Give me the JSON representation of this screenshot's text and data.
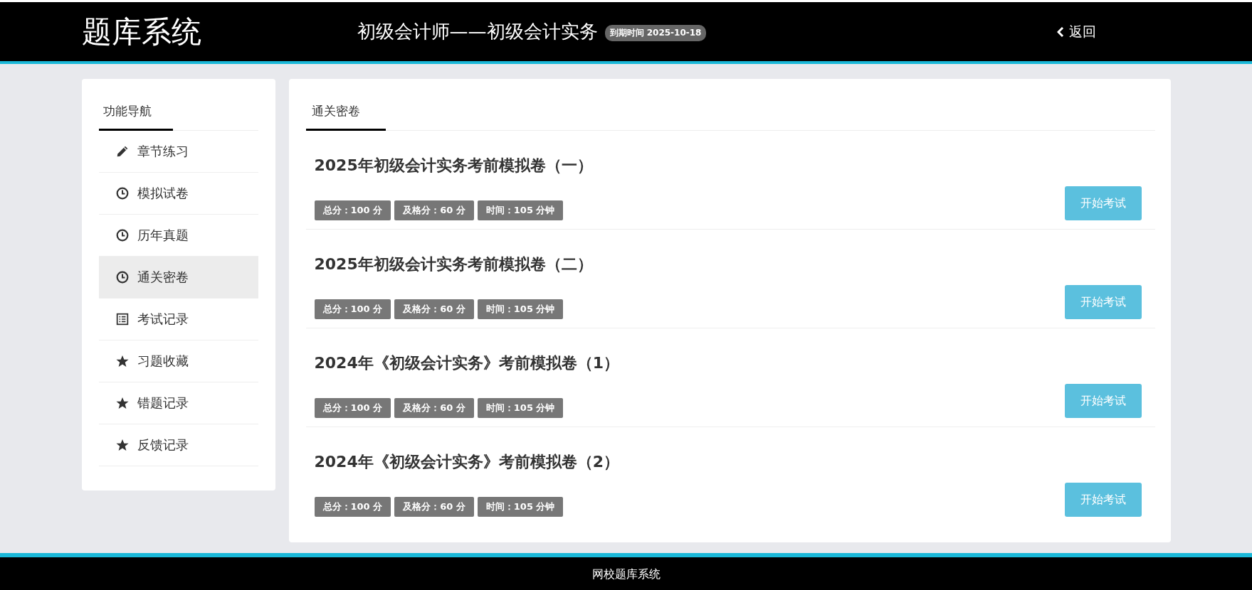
{
  "header": {
    "logo": "题库系统",
    "course": "初级会计师——初级会计实务",
    "expiry": "到期时间 2025-10-18",
    "back": "返回"
  },
  "sidebar": {
    "heading": "功能导航",
    "items": [
      {
        "label": "章节练习",
        "kind": "pencil",
        "selected": false
      },
      {
        "label": "模拟试卷",
        "kind": "clock",
        "selected": false
      },
      {
        "label": "历年真题",
        "kind": "clock",
        "selected": false
      },
      {
        "label": "通关密卷",
        "kind": "clock",
        "selected": true
      },
      {
        "label": "考试记录",
        "kind": "list",
        "selected": false
      },
      {
        "label": "习题收藏",
        "kind": "star",
        "selected": false
      },
      {
        "label": "错题记录",
        "kind": "star",
        "selected": false
      },
      {
        "label": "反馈记录",
        "kind": "star",
        "selected": false
      }
    ]
  },
  "main": {
    "tabs": [
      {
        "label": "通关密卷",
        "selected": true
      }
    ],
    "papers": [
      {
        "title": "2025年初级会计实务考前模拟卷（一）",
        "tags": [
          "总分：100 分",
          "及格分：60 分",
          "时间：105 分钟"
        ],
        "button": "开始考试"
      },
      {
        "title": "2025年初级会计实务考前模拟卷（二）",
        "tags": [
          "总分：100 分",
          "及格分：60 分",
          "时间：105 分钟"
        ],
        "button": "开始考试"
      },
      {
        "title": "2024年《初级会计实务》考前模拟卷（1）",
        "tags": [
          "总分：100 分",
          "及格分：60 分",
          "时间：105 分钟"
        ],
        "button": "开始考试"
      },
      {
        "title": "2024年《初级会计实务》考前模拟卷（2）",
        "tags": [
          "总分：100 分",
          "及格分：60 分",
          "时间：105 分钟"
        ],
        "button": "开始考试"
      }
    ]
  },
  "footer": {
    "text": "网校题库系统"
  }
}
